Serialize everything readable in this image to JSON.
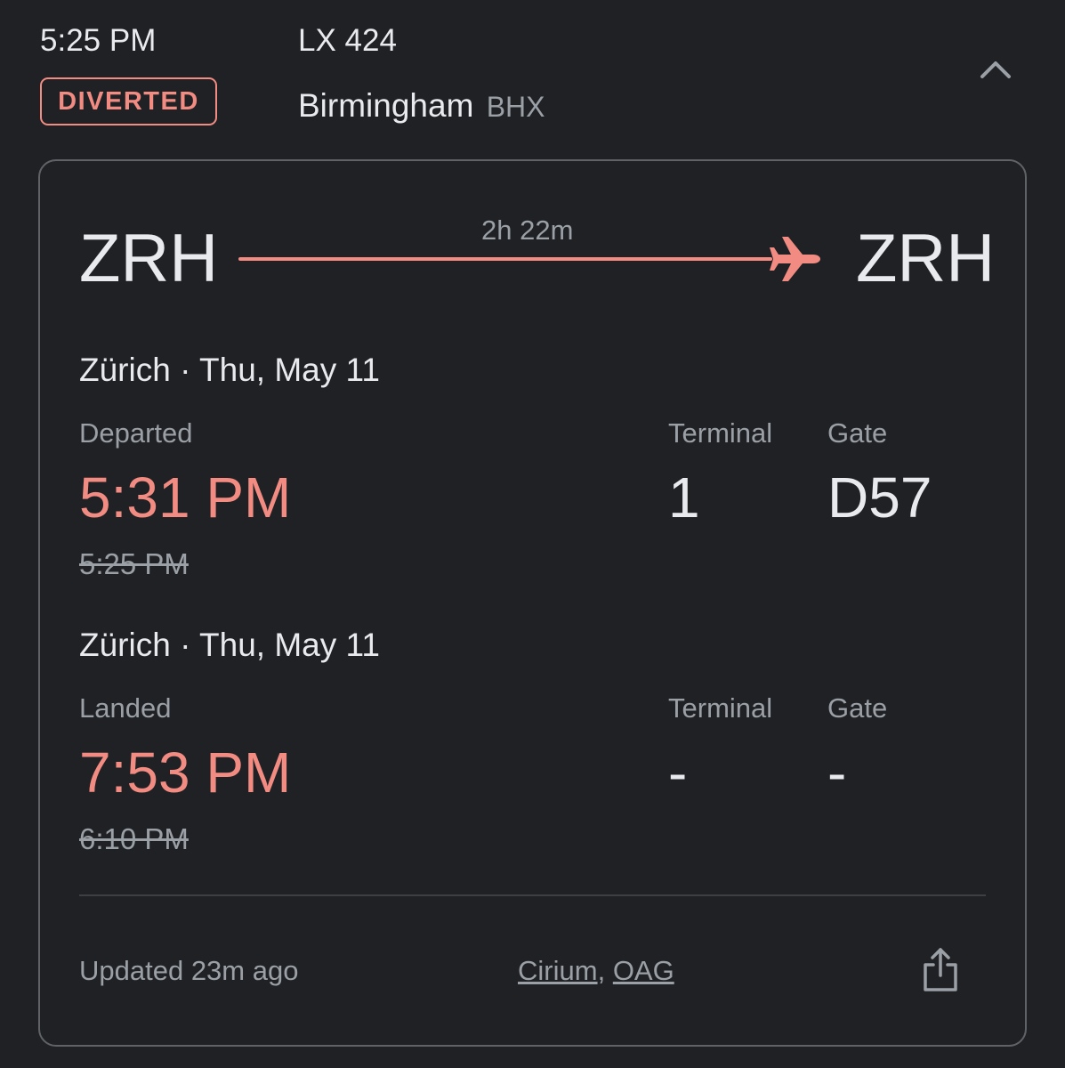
{
  "header": {
    "scheduled_time": "5:25 PM",
    "flight_number": "LX 424",
    "status": "DIVERTED",
    "diverted_to_city": "Birmingham",
    "diverted_to_code": "BHX"
  },
  "route": {
    "origin_code": "ZRH",
    "destination_code": "ZRH",
    "duration": "2h 22m"
  },
  "departure": {
    "city_date": "Zürich · Thu, May 11",
    "status_label": "Departed",
    "actual_time": "5:31 PM",
    "scheduled_time": "5:25 PM",
    "terminal_label": "Terminal",
    "terminal": "1",
    "gate_label": "Gate",
    "gate": "D57"
  },
  "arrival": {
    "city_date": "Zürich · Thu, May 11",
    "status_label": "Landed",
    "actual_time": "7:53 PM",
    "scheduled_time": "6:10 PM",
    "terminal_label": "Terminal",
    "terminal": "-",
    "gate_label": "Gate",
    "gate": "-"
  },
  "footer": {
    "updated": "Updated 23m ago",
    "source_1": "Cirium",
    "separator": ",",
    "source_2": "OAG"
  },
  "colors": {
    "background": "#202124",
    "accent": "#f28b82",
    "text_primary": "#e8eaed",
    "text_secondary": "#9aa0a6"
  },
  "icons": {
    "collapse": "chevron-up-icon",
    "plane": "airplane-icon",
    "share": "share-icon"
  }
}
